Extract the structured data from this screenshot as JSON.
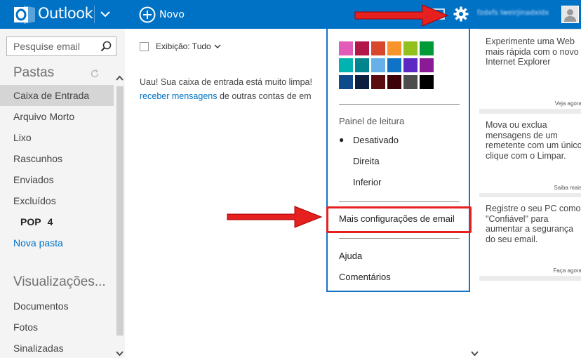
{
  "header": {
    "app_title": "Outlook",
    "new_label": "Novo",
    "user_name": "fzdxfs lweirjinadxidx",
    "colors": {
      "bar": "#0072c6",
      "text": "#ffffff"
    }
  },
  "sidebar": {
    "search_placeholder": "Pesquise email",
    "folders_heading": "Pastas",
    "folders": [
      {
        "label": "Caixa de Entrada",
        "selected": true
      },
      {
        "label": "Arquivo Morto"
      },
      {
        "label": "Lixo"
      },
      {
        "label": "Rascunhos"
      },
      {
        "label": "Enviados"
      },
      {
        "label": "Excluídos"
      }
    ],
    "pop": {
      "label": "POP",
      "count": "4"
    },
    "new_folder": "Nova pasta",
    "views_heading": "Visualizações...",
    "views": [
      {
        "label": "Documentos"
      },
      {
        "label": "Fotos"
      },
      {
        "label": "Sinalizadas"
      }
    ]
  },
  "main": {
    "filter_label": "Exibição: Tudo",
    "empty_line1": "Uau! Sua caixa de entrada está muito limpa!",
    "empty_link": "receber mensagens",
    "empty_line2_rest": " de outras contas de em"
  },
  "settings_menu": {
    "theme_colors": [
      "#e35bb8",
      "#b2174a",
      "#d8472b",
      "#f7942c",
      "#92c11e",
      "#009a36",
      "#ffffff",
      "#00b3b0",
      "#00848d",
      "#67b0e9",
      "#0f73c8",
      "#5d27c3",
      "#8b1a97",
      "#ffffff",
      "#0d4b8b",
      "#0c213f",
      "#5a0c11",
      "#3d0009",
      "#4d4d4d",
      "#000000",
      "#ffffff"
    ],
    "reading_pane_label": "Painel de leitura",
    "reading_pane_options": [
      {
        "label": "Desativado",
        "selected": true,
        "bullet": "●"
      },
      {
        "label": "Direita",
        "selected": false
      },
      {
        "label": "Inferior",
        "selected": false
      }
    ],
    "more_settings": "Mais configurações de email",
    "help": "Ajuda",
    "feedback": "Comentários"
  },
  "ads": [
    {
      "text": "Experimente uma Web mais rápida com o novo Internet Explorer",
      "footer": "Veja agora"
    },
    {
      "text": "Mova ou exclua mensagens de um remetente com um único clique com o Limpar.",
      "footer": "Saiba mais"
    },
    {
      "text": "Registre o seu PC como \"Confiável\" para aumentar a segurança do seu email.",
      "footer": "Faça agora"
    }
  ],
  "annotation_color": "#e61f1f"
}
